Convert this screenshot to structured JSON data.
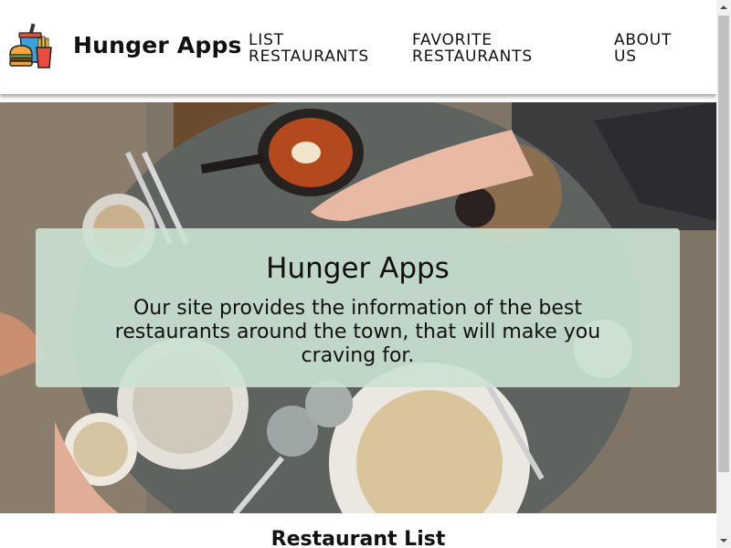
{
  "header": {
    "brand": "Hunger Apps",
    "logo_icon": "fastfood-icon",
    "nav": [
      {
        "label": "LIST RESTAURANTS"
      },
      {
        "label": "FAVORITE RESTAURANTS"
      },
      {
        "label": "ABOUT US"
      }
    ]
  },
  "hero": {
    "title": "Hunger Apps",
    "text": "Our site provides the information of the best restaurants around the town, that will make you craving for.",
    "image": "restaurant-table-photo"
  },
  "section": {
    "title": "Restaurant List"
  },
  "colors": {
    "header_bg": "#ffffff",
    "hero_card": "#cbe2d2",
    "text": "#111111"
  }
}
